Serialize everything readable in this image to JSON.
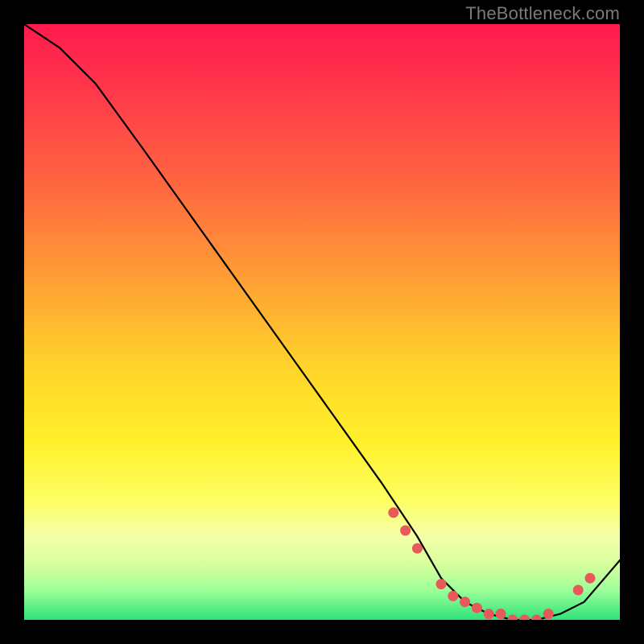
{
  "watermark": "TheBottleneck.com",
  "chart_data": {
    "type": "line",
    "title": "",
    "xlabel": "",
    "ylabel": "",
    "xlim": [
      0,
      100
    ],
    "ylim": [
      0,
      100
    ],
    "series": [
      {
        "name": "bottleneck-curve",
        "x": [
          0,
          6,
          12,
          20,
          30,
          40,
          50,
          60,
          66,
          70,
          74,
          78,
          82,
          86,
          90,
          94,
          100
        ],
        "values": [
          100,
          96,
          90,
          79,
          65,
          51,
          37,
          23,
          14,
          7,
          3,
          1,
          0,
          0,
          1,
          3,
          10
        ]
      }
    ],
    "markers": {
      "name": "highlight-points",
      "x": [
        62,
        64,
        66,
        70,
        72,
        74,
        76,
        78,
        80,
        82,
        84,
        86,
        88,
        93,
        95
      ],
      "values": [
        18,
        15,
        12,
        6,
        4,
        3,
        2,
        1,
        1,
        0,
        0,
        0,
        1,
        5,
        7
      ],
      "color": "#e85a5a"
    },
    "background_gradient": [
      {
        "stop": 0,
        "color": "#ff1a4d"
      },
      {
        "stop": 28,
        "color": "#ff6a3f"
      },
      {
        "stop": 58,
        "color": "#ffd52a"
      },
      {
        "stop": 80,
        "color": "#fdff63"
      },
      {
        "stop": 95,
        "color": "#9dff99"
      },
      {
        "stop": 100,
        "color": "#2fe37a"
      }
    ]
  }
}
